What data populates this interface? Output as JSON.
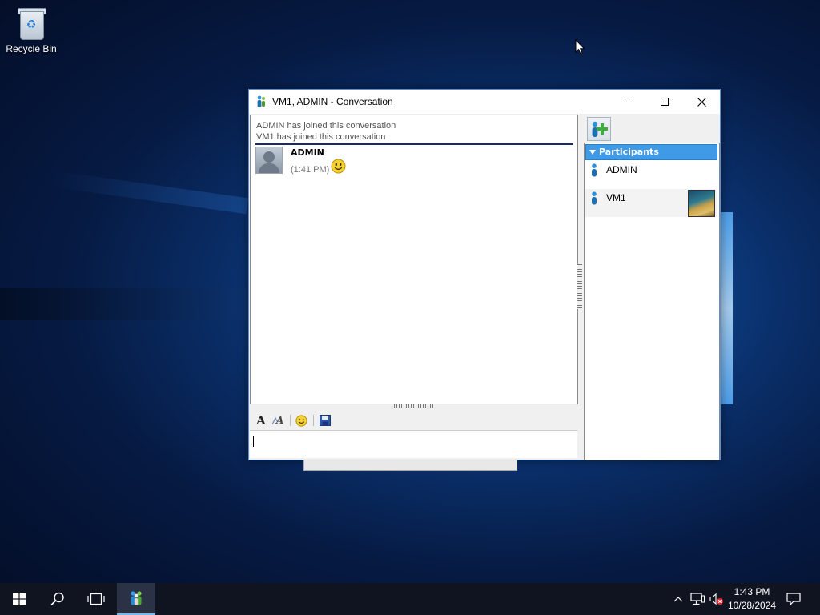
{
  "desktop": {
    "icons": [
      {
        "label": "Recycle Bin",
        "icon": "recycle-bin-icon"
      }
    ]
  },
  "window": {
    "title": "VM1, ADMIN - Conversation",
    "buttons": {
      "minimize": "minimize-icon",
      "maximize": "maximize-icon",
      "close": "close-icon"
    },
    "system_messages": [
      "ADMIN has joined this conversation",
      "VM1 has joined this conversation"
    ],
    "messages": [
      {
        "sender": "ADMIN",
        "time": "(1:41 PM)",
        "content": "smiley-emoticon"
      }
    ],
    "format_toolbar": [
      "font-icon",
      "font-color-icon",
      "emoticon-icon",
      "save-icon"
    ],
    "input": {
      "value": "",
      "placeholder": ""
    },
    "participants": {
      "header": "Participants",
      "items": [
        {
          "name": "ADMIN",
          "icon": "user-icon"
        },
        {
          "name": "VM1",
          "icon": "user-icon",
          "has_picture": true
        }
      ]
    }
  },
  "taskbar": {
    "items": [
      "start-icon",
      "search-icon",
      "task-view-icon",
      "windows-meeting-space-icon"
    ],
    "tray": [
      "chevron-up-icon",
      "network-icon",
      "volume-muted-icon",
      "notification-icon"
    ],
    "clock": {
      "time": "1:43 PM",
      "date": "10/28/2024"
    }
  },
  "colors": {
    "accent": "#3f9ae8",
    "taskbar": "#101420",
    "divider": "#1a2a6c"
  }
}
